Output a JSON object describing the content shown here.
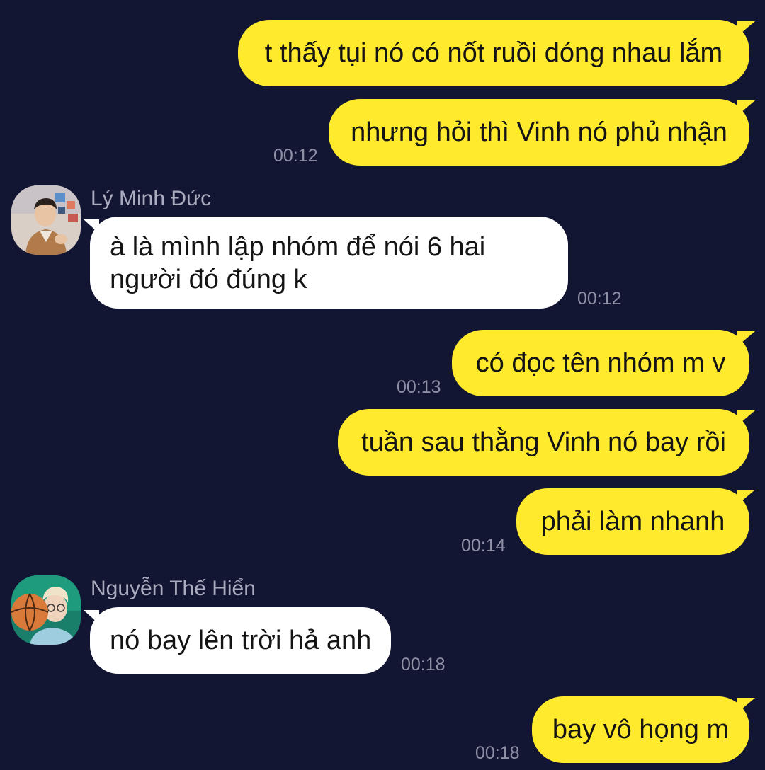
{
  "colors": {
    "background": "#131633",
    "outgoing_bubble": "#FFEA2E",
    "incoming_bubble": "#FFFFFF",
    "timestamp": "#8E90A6",
    "sender_name": "#A9ABBE"
  },
  "messages": [
    {
      "direction": "outgoing",
      "text": "t thấy tụi nó có nốt ruồi dóng nhau lắm"
    },
    {
      "direction": "outgoing",
      "text": "nhưng hỏi thì Vinh nó phủ nhận",
      "time": "00:12"
    },
    {
      "direction": "incoming",
      "sender": "Lý Minh Đức",
      "avatar": "young-man-photo-avatar",
      "line1": "à là mình lập nhóm để nói 6 hai",
      "line2": "người đó đúng k",
      "time": "00:12"
    },
    {
      "direction": "outgoing",
      "text": "có đọc tên nhóm m v",
      "time": "00:13"
    },
    {
      "direction": "outgoing",
      "text": "tuần sau thằng Vinh nó bay rồi"
    },
    {
      "direction": "outgoing",
      "text": "phải làm nhanh",
      "time": "00:14"
    },
    {
      "direction": "incoming",
      "sender": "Nguyễn Thế Hiển",
      "avatar": "basketball-player-photo-avatar",
      "text": "nó bay lên trời hả anh",
      "time": "00:18"
    },
    {
      "direction": "outgoing",
      "text": "bay vô họng m",
      "time": "00:18"
    }
  ]
}
